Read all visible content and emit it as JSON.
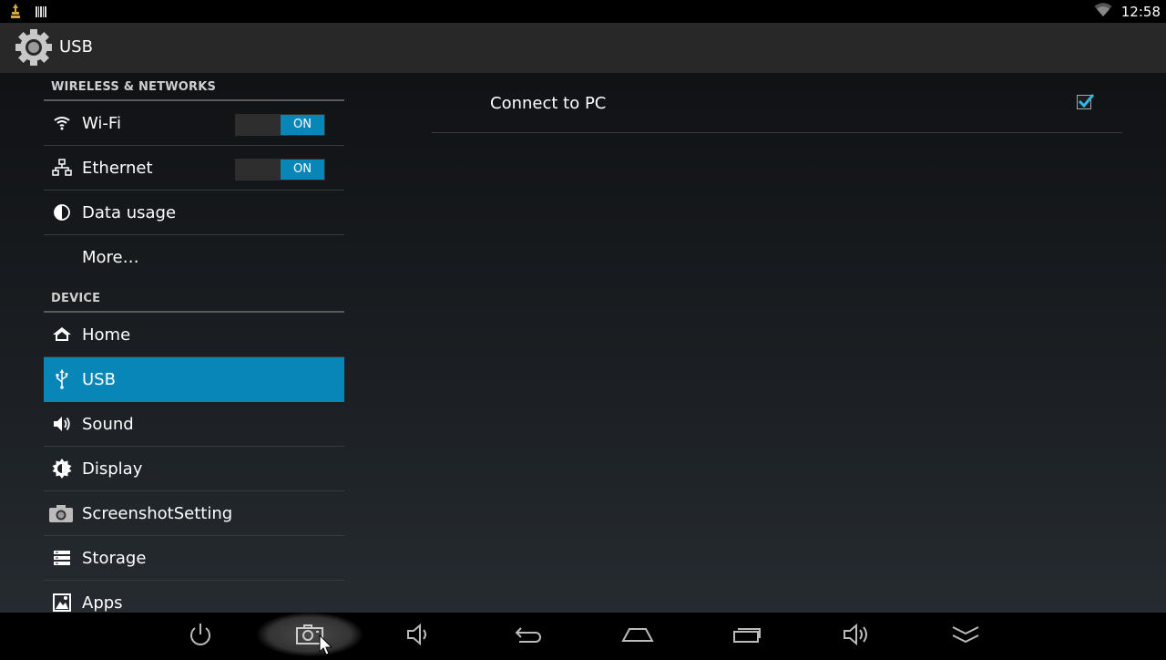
{
  "status_bar": {
    "time": "12:58",
    "icons": [
      "notification-usb-debug-icon",
      "barcode-icon",
      "wifi-signal-icon"
    ]
  },
  "action_bar": {
    "icon": "settings-gear-icon",
    "title": "USB"
  },
  "sidebar": {
    "sections": [
      {
        "header": "WIRELESS & NETWORKS",
        "items": [
          {
            "label": "Wi-Fi",
            "icon": "wifi-icon",
            "toggle": "ON"
          },
          {
            "label": "Ethernet",
            "icon": "ethernet-icon",
            "toggle": "ON"
          },
          {
            "label": "Data usage",
            "icon": "data-usage-icon"
          },
          {
            "label": "More…",
            "icon": ""
          }
        ]
      },
      {
        "header": "DEVICE",
        "items": [
          {
            "label": "Home",
            "icon": "home-icon"
          },
          {
            "label": "USB",
            "icon": "usb-icon",
            "selected": true
          },
          {
            "label": "Sound",
            "icon": "sound-icon"
          },
          {
            "label": "Display",
            "icon": "display-brightness-icon"
          },
          {
            "label": "ScreenshotSetting",
            "icon": "camera-icon"
          },
          {
            "label": "Storage",
            "icon": "storage-icon"
          },
          {
            "label": "Apps",
            "icon": "apps-icon"
          }
        ]
      }
    ]
  },
  "detail": {
    "connect_to_pc": {
      "label": "Connect to PC",
      "checked": true
    }
  },
  "nav_bar": {
    "buttons": [
      "power-icon",
      "screenshot-icon",
      "volume-down-icon",
      "back-icon",
      "home-icon",
      "recent-apps-icon",
      "volume-up-icon",
      "collapse-icon"
    ]
  },
  "colors": {
    "accent": "#0986b8",
    "background": "#000000",
    "action_bar": "#282828"
  }
}
